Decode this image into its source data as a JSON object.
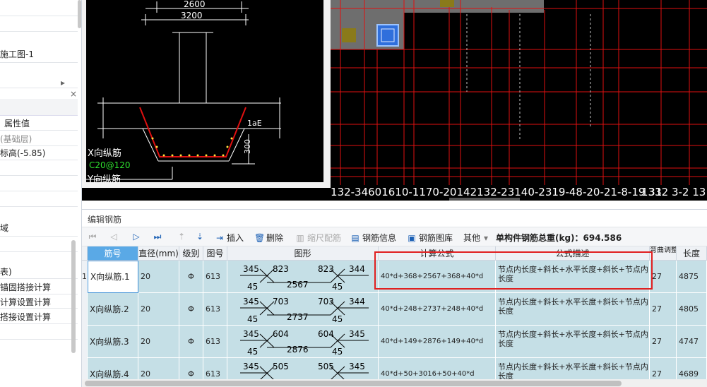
{
  "left_panel": {
    "drawing_item": "施工图-1",
    "prop_header": "属性值",
    "layer_value": "(基础层)",
    "elevation_value": "标高(-5.85)",
    "item_a": "域",
    "item_b": "表)",
    "item_c": "锚固搭接计算",
    "item_d": "计算设置计算",
    "item_e": "搭接设置计算",
    "close_glyph": "×"
  },
  "cad": {
    "dims": [
      "2600",
      "3200",
      "1aE",
      "300"
    ],
    "labels": [
      "X向纵筋",
      "C20@120",
      "Y向纵筋"
    ],
    "axis_labels": "132-34601610-1170-20142132-23140-2319-48-20-21-8-19 31",
    "axis_tail": "1332 3-2 13"
  },
  "editor": {
    "title": "编辑钢筋",
    "toolbar": {
      "insert": "插入",
      "delete": "删除",
      "scale": "缩尺配筋",
      "info": "钢筋信息",
      "library": "钢筋图库",
      "other": "其他",
      "total": "单构件钢筋总重(kg)：694.586"
    },
    "columns": [
      "筋号",
      "直径(mm)",
      "级别",
      "图号",
      "图形",
      "计算公式",
      "公式描述",
      "弯曲调整",
      "长度"
    ],
    "rows": [
      {
        "num": "1",
        "name": "X向纵筋.1",
        "diameter": "20",
        "grade": "Φ",
        "fig": "613",
        "s1": "345",
        "s2": "823",
        "s3": "823",
        "s4": "344",
        "s5": "45",
        "s6": "2567",
        "s7": "45",
        "formula": "40*d+368+2567+368+40*d",
        "desc": "节点内长度+斜长+水平长度+斜长+节点内长度",
        "bend": "27",
        "length": "4875"
      },
      {
        "num": "",
        "name": "X向纵筋.2",
        "diameter": "20",
        "grade": "Φ",
        "fig": "613",
        "s1": "345",
        "s2": "703",
        "s3": "703",
        "s4": "344",
        "s5": "45",
        "s6": "2737",
        "s7": "45",
        "formula": "40*d+248+2737+248+40*d",
        "desc": "节点内长度+斜长+水平长度+斜长+节点内长度",
        "bend": "27",
        "length": "4805"
      },
      {
        "num": "",
        "name": "X向纵筋.3",
        "diameter": "20",
        "grade": "Φ",
        "fig": "613",
        "s1": "345",
        "s2": "604",
        "s3": "604",
        "s4": "345",
        "s5": "45",
        "s6": "2876",
        "s7": "45",
        "formula": "40*d+149+2876+149+40*d",
        "desc": "节点内长度+斜长+水平长度+斜长+节点内长度",
        "bend": "27",
        "length": "4747"
      },
      {
        "num": "",
        "name": "X向纵筋.4",
        "diameter": "20",
        "grade": "Φ",
        "fig": "613",
        "s1": "345",
        "s2": "505",
        "s3": "505",
        "s4": "345",
        "s5": "",
        "s6": "",
        "s7": "",
        "formula": "40*d+50+3016+50+40*d",
        "desc": "节点内长度+斜长+水平长度+斜长+节点内长度",
        "bend": "27",
        "length": "4689"
      }
    ]
  },
  "colors": {
    "highlight_box": "#e02020",
    "row_bg": "#c5dfe6",
    "cad_red": "#e01010"
  }
}
